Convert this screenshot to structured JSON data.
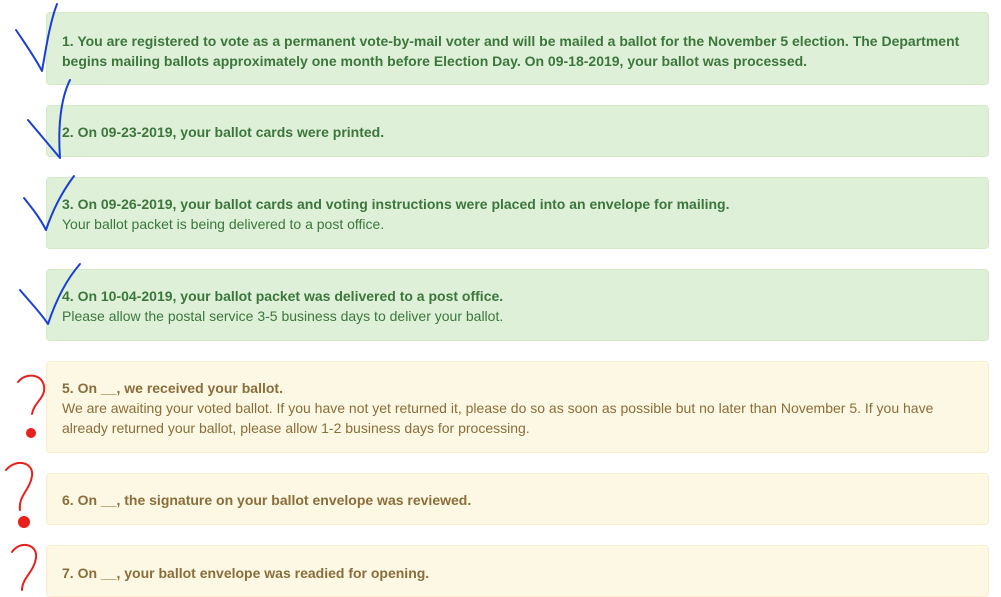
{
  "steps": [
    {
      "status": "complete",
      "title": "1. You are registered to vote as a permanent vote-by-mail voter and will be mailed a ballot for the November 5 election. The Department begins mailing ballots approximately one month before Election Day. On 09-18-2019, your ballot was processed.",
      "detail": ""
    },
    {
      "status": "complete",
      "title": "2. On 09-23-2019, your ballot cards were printed.",
      "detail": ""
    },
    {
      "status": "complete",
      "title": "3. On 09-26-2019, your ballot cards and voting instructions were placed into an envelope for mailing.",
      "detail": "Your ballot packet is being delivered to a post office."
    },
    {
      "status": "complete",
      "title": "4. On 10-04-2019, your ballot packet was delivered to a post office.",
      "detail": "Please allow the postal service 3-5 business days to deliver your ballot."
    },
    {
      "status": "pending",
      "title": "5. On __, we received your ballot.",
      "detail": "We are awaiting your voted ballot. If you have not yet returned it, please do so as soon as possible but no later than November 5. If you have already returned your ballot, please allow 1-2 business days for processing."
    },
    {
      "status": "pending",
      "title": "6. On __, the signature on your ballot envelope was reviewed.",
      "detail": ""
    },
    {
      "status": "pending",
      "title": "7. On __, your ballot envelope was readied for opening.",
      "detail": ""
    }
  ],
  "annotations": {
    "complete_mark": "blue-checkmark",
    "pending_mark": "red-question-mark",
    "complete_color": "#1a3fd6",
    "pending_color": "#e8201c"
  }
}
